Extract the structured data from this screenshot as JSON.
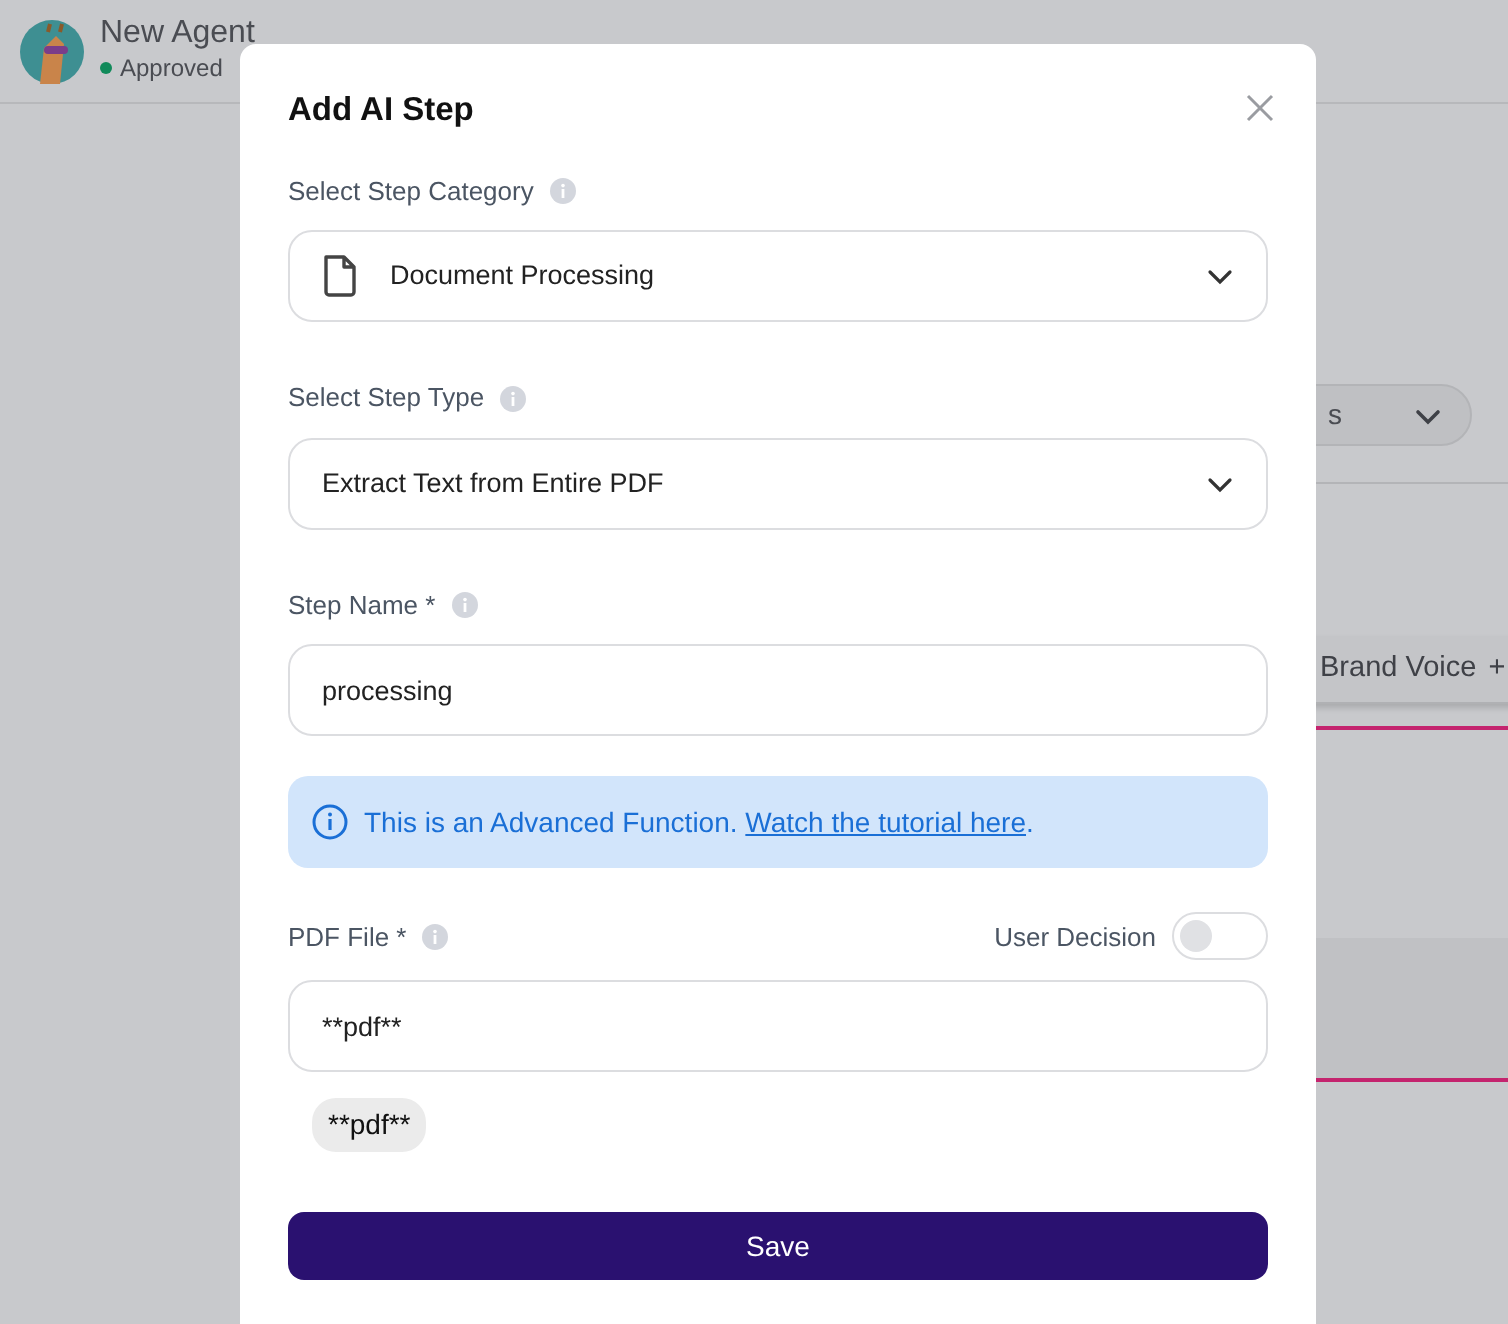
{
  "header": {
    "title": "New Agent",
    "status": "Approved"
  },
  "background": {
    "dropdown_text": "s",
    "tab_label": "Brand Voice",
    "tab_add": "+"
  },
  "modal": {
    "title": "Add AI Step",
    "fields": [
      {
        "kind": "select",
        "label": "Select Step Category",
        "value": "Document Processing"
      },
      {
        "kind": "select",
        "label": "Select Step Type",
        "value": "Extract Text from Entire PDF"
      },
      {
        "kind": "input",
        "label": "Step Name *",
        "value": "processing"
      }
    ],
    "alert": {
      "text": "This is an Advanced Function.",
      "link": "Watch the tutorial here",
      "after": "."
    },
    "pdf_field": {
      "label": "PDF File *",
      "toggle_label": "User Decision",
      "on": false,
      "value": "**pdf**",
      "chip": "**pdf**"
    },
    "save": "Save"
  }
}
